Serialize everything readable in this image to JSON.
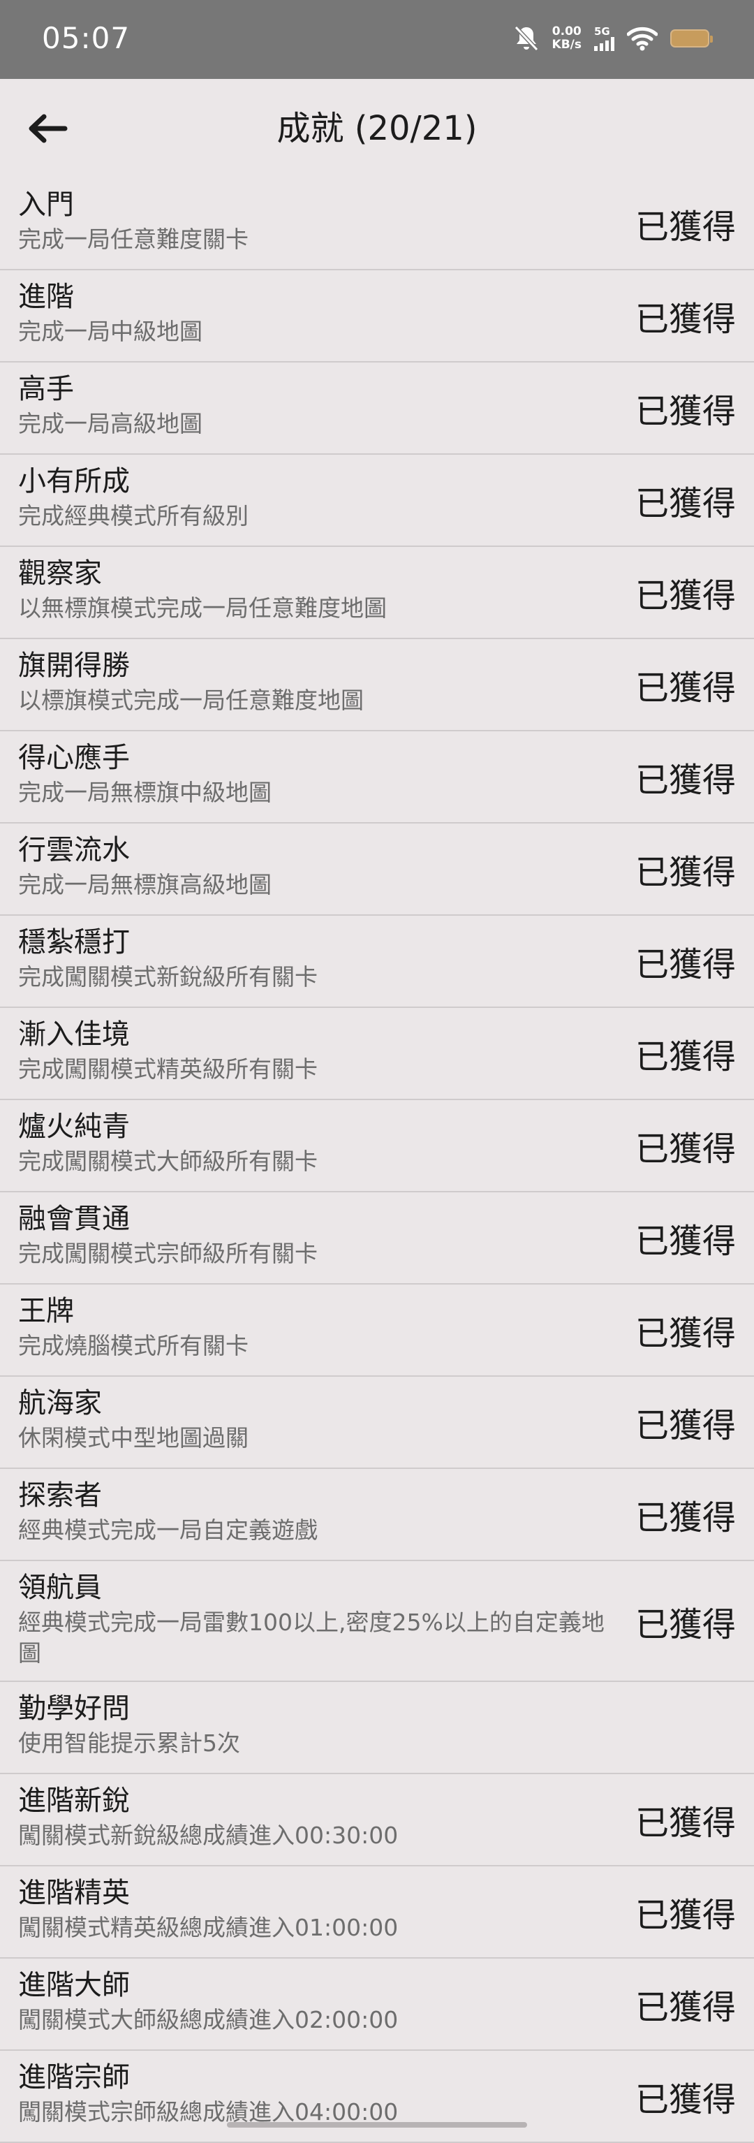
{
  "status_bar": {
    "time": "05:07",
    "net_speed_value": "0.00",
    "net_speed_unit": "KB/s",
    "network_type": "5G"
  },
  "header": {
    "title": "成就 (20/21)"
  },
  "achievements": [
    {
      "title": "入門",
      "desc": "完成一局任意難度關卡",
      "status": "已獲得"
    },
    {
      "title": "進階",
      "desc": "完成一局中級地圖",
      "status": "已獲得"
    },
    {
      "title": "高手",
      "desc": "完成一局高級地圖",
      "status": "已獲得"
    },
    {
      "title": "小有所成",
      "desc": "完成經典模式所有級別",
      "status": "已獲得"
    },
    {
      "title": "觀察家",
      "desc": "以無標旗模式完成一局任意難度地圖",
      "status": "已獲得"
    },
    {
      "title": "旗開得勝",
      "desc": "以標旗模式完成一局任意難度地圖",
      "status": "已獲得"
    },
    {
      "title": "得心應手",
      "desc": "完成一局無標旗中級地圖",
      "status": "已獲得"
    },
    {
      "title": "行雲流水",
      "desc": "完成一局無標旗高級地圖",
      "status": "已獲得"
    },
    {
      "title": "穩紮穩打",
      "desc": "完成闖關模式新銳級所有關卡",
      "status": "已獲得"
    },
    {
      "title": "漸入佳境",
      "desc": "完成闖關模式精英級所有關卡",
      "status": "已獲得"
    },
    {
      "title": "爐火純青",
      "desc": "完成闖關模式大師級所有關卡",
      "status": "已獲得"
    },
    {
      "title": "融會貫通",
      "desc": "完成闖關模式宗師級所有關卡",
      "status": "已獲得"
    },
    {
      "title": "王牌",
      "desc": "完成燒腦模式所有關卡",
      "status": "已獲得"
    },
    {
      "title": "航海家",
      "desc": "休閑模式中型地圖過關",
      "status": "已獲得"
    },
    {
      "title": "探索者",
      "desc": "經典模式完成一局自定義遊戲",
      "status": "已獲得"
    },
    {
      "title": "領航員",
      "desc": "經典模式完成一局雷數100以上,密度25%以上的自定義地圖",
      "status": "已獲得"
    },
    {
      "title": "勤學好問",
      "desc": "使用智能提示累計5次",
      "status": ""
    },
    {
      "title": "進階新銳",
      "desc": "闖關模式新銳級總成績進入00:30:00",
      "status": "已獲得"
    },
    {
      "title": "進階精英",
      "desc": "闖關模式精英級總成績進入01:00:00",
      "status": "已獲得"
    },
    {
      "title": "進階大師",
      "desc": "闖關模式大師級總成績進入02:00:00",
      "status": "已獲得"
    },
    {
      "title": "進階宗師",
      "desc": "闖關模式宗師級總成績進入04:00:00",
      "status": "已獲得"
    }
  ]
}
